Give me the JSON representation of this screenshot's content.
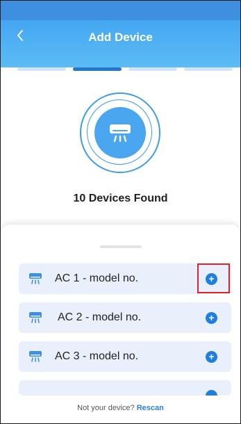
{
  "header": {
    "back_icon": "chevron-left-icon",
    "title": "Add Device"
  },
  "progress": {
    "total_steps": 4,
    "current_step": 2
  },
  "scan": {
    "device_icon": "air-conditioner-icon",
    "found_text": "10 Devices Found"
  },
  "devices": [
    {
      "label": "AC 1 - model no.",
      "icon": "air-conditioner-icon",
      "action_icon": "add-circle-icon"
    },
    {
      "label": "AC 2 - model no.",
      "icon": "air-conditioner-icon",
      "action_icon": "add-circle-icon"
    },
    {
      "label": "AC 3 - model no.",
      "icon": "air-conditioner-icon",
      "action_icon": "add-circle-icon"
    }
  ],
  "footer": {
    "prompt": "Not your device?",
    "rescan_label": "Rescan"
  },
  "colors": {
    "header": "#4aa6ee",
    "accent": "#1e7fe0",
    "row_background": "#e9f0fb",
    "highlight": "#e32227"
  }
}
